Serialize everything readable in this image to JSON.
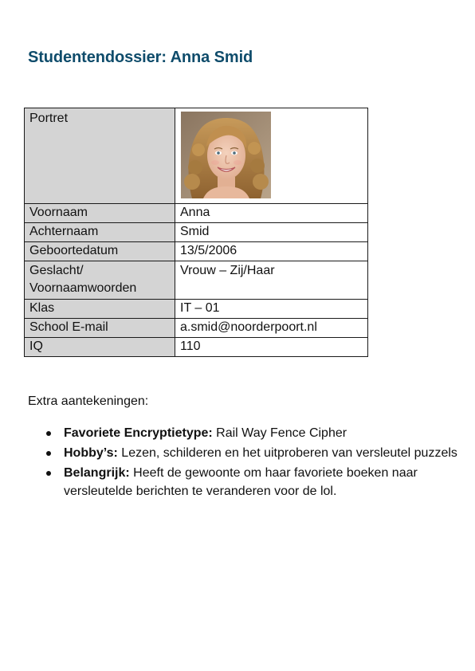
{
  "document": {
    "title": "Studentendossier: Anna Smid"
  },
  "profile_table": {
    "portrait_label": "Portret",
    "portrait_icon": "student-photo",
    "rows": [
      {
        "label": "Voornaam",
        "value": "Anna"
      },
      {
        "label": "Achternaam",
        "value": "Smid"
      },
      {
        "label": "Geboortedatum",
        "value": "13/5/2006"
      },
      {
        "label": "Geslacht/ Voornaamwoorden",
        "value": "Vrouw – Zij/Haar"
      },
      {
        "label": "Klas",
        "value": "IT – 01"
      },
      {
        "label": "School E-mail",
        "value": "a.smid@noorderpoort.nl"
      },
      {
        "label": "IQ",
        "value": "110"
      }
    ]
  },
  "notes": {
    "heading": "Extra aantekeningen:",
    "items": [
      {
        "label": "Favoriete Encryptietype:",
        "text": "Rail Way Fence Cipher"
      },
      {
        "label": "Hobby’s:",
        "text": "Lezen, schilderen en het uitproberen van versleutel puzzels"
      },
      {
        "label": "Belangrijk:",
        "text": "Heeft de gewoonte om haar favoriete boeken naar versleutelde berichten te veranderen voor de lol."
      }
    ]
  },
  "colors": {
    "title": "#0f4c6b",
    "label_cell_bg": "#d4d4d4",
    "border": "#1a1a1a"
  }
}
